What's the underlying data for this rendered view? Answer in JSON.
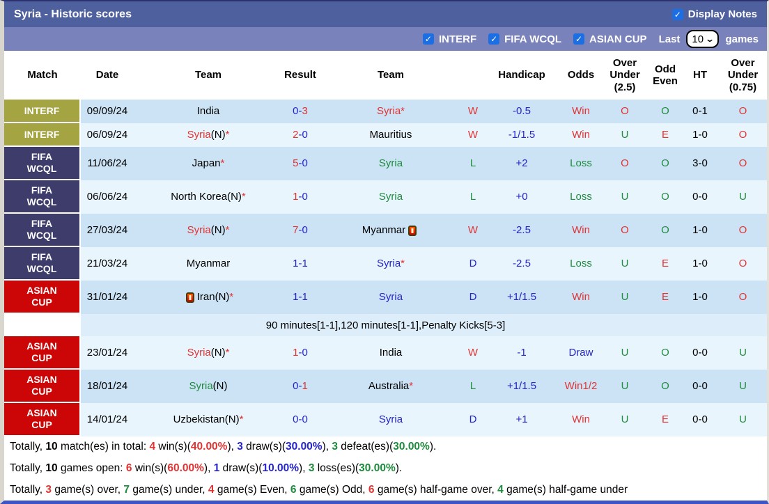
{
  "title_bar": {
    "title": "Syria - Historic scores",
    "display_notes_label": "Display Notes"
  },
  "filter_bar": {
    "filters": [
      "INTERF",
      "FIFA WCQL",
      "ASIAN CUP"
    ],
    "last_label": "Last",
    "games_count": "10",
    "games_label": "games"
  },
  "colors": {
    "red": "#e23333",
    "blue": "#2525cc",
    "green": "#1e8c3c",
    "black": "#000000",
    "interf_bg": "#a4a443",
    "fifa_bg": "#3d3c6b",
    "asian_bg": "#cc0606",
    "stripe_dark": "#cbe3f4",
    "stripe_light": "#e9f5fd",
    "note_bg": "#ddeefa",
    "title_bar_bg": "#4f609f",
    "filter_bar_bg": "#7982ba",
    "checkbox_blue": "#1b6fe3"
  },
  "table": {
    "headers": [
      "Match",
      "Date",
      "Team",
      "Result",
      "Team",
      "",
      "Handicap",
      "Odds",
      "Over Under (2.5)",
      "Odd Even",
      "HT",
      "Over Under (0.75)"
    ],
    "rows": [
      {
        "match": {
          "label": "INTERF",
          "comp": "interf"
        },
        "h": 34,
        "stripe": "d",
        "date": "09/09/24",
        "team1": [
          {
            "t": "India",
            "c": "k"
          }
        ],
        "result": [
          {
            "t": "0-",
            "c": "b"
          },
          {
            "t": "3",
            "c": "r"
          }
        ],
        "team2": [
          {
            "t": "Syria",
            "c": "r"
          },
          {
            "t": "*",
            "c": "r"
          }
        ],
        "wdl": [
          {
            "t": "W",
            "c": "r"
          }
        ],
        "handicap": "-0.5",
        "odds": [
          {
            "t": "Win",
            "c": "r"
          }
        ],
        "ou25": [
          {
            "t": "O",
            "c": "r"
          }
        ],
        "oddeven": [
          {
            "t": "O",
            "c": "g"
          }
        ],
        "ht": "0-1",
        "ou075": [
          {
            "t": "O",
            "c": "r"
          }
        ]
      },
      {
        "match": {
          "label": "INTERF",
          "comp": "interf"
        },
        "h": 34,
        "stripe": "l",
        "date": "06/09/24",
        "team1": [
          {
            "t": "Syria",
            "c": "r"
          },
          {
            "t": "(N)",
            "c": "k"
          },
          {
            "t": "*",
            "c": "r"
          }
        ],
        "result": [
          {
            "t": "2",
            "c": "r"
          },
          {
            "t": "-0",
            "c": "b"
          }
        ],
        "team2": [
          {
            "t": "Mauritius",
            "c": "k"
          }
        ],
        "wdl": [
          {
            "t": "W",
            "c": "r"
          }
        ],
        "handicap": "-1/1.5",
        "odds": [
          {
            "t": "Win",
            "c": "r"
          }
        ],
        "ou25": [
          {
            "t": "U",
            "c": "g"
          }
        ],
        "oddeven": [
          {
            "t": "E",
            "c": "r"
          }
        ],
        "ht": "1-0",
        "ou075": [
          {
            "t": "O",
            "c": "r"
          }
        ]
      },
      {
        "match": {
          "label": "FIFA\nWCQL",
          "comp": "fifa"
        },
        "h": 48,
        "stripe": "d",
        "date": "11/06/24",
        "team1": [
          {
            "t": "Japan",
            "c": "k"
          },
          {
            "t": "*",
            "c": "r"
          }
        ],
        "result": [
          {
            "t": "5",
            "c": "r"
          },
          {
            "t": "-0",
            "c": "b"
          }
        ],
        "team2": [
          {
            "t": "Syria",
            "c": "g"
          }
        ],
        "wdl": [
          {
            "t": "L",
            "c": "g"
          }
        ],
        "handicap": "+2",
        "odds": [
          {
            "t": "Loss",
            "c": "g"
          }
        ],
        "ou25": [
          {
            "t": "O",
            "c": "r"
          }
        ],
        "oddeven": [
          {
            "t": "O",
            "c": "g"
          }
        ],
        "ht": "3-0",
        "ou075": [
          {
            "t": "O",
            "c": "r"
          }
        ]
      },
      {
        "match": {
          "label": "FIFA\nWCQL",
          "comp": "fifa"
        },
        "h": 48,
        "stripe": "l",
        "date": "06/06/24",
        "team1": [
          {
            "t": "North Korea(N)",
            "c": "k"
          },
          {
            "t": "*",
            "c": "r"
          }
        ],
        "result": [
          {
            "t": "1",
            "c": "r"
          },
          {
            "t": "-0",
            "c": "b"
          }
        ],
        "team2": [
          {
            "t": "Syria",
            "c": "g"
          }
        ],
        "wdl": [
          {
            "t": "L",
            "c": "g"
          }
        ],
        "handicap": "+0",
        "odds": [
          {
            "t": "Loss",
            "c": "g"
          }
        ],
        "ou25": [
          {
            "t": "U",
            "c": "g"
          }
        ],
        "oddeven": [
          {
            "t": "O",
            "c": "g"
          }
        ],
        "ht": "0-0",
        "ou075": [
          {
            "t": "U",
            "c": "g"
          }
        ]
      },
      {
        "match": {
          "label": "FIFA\nWCQL",
          "comp": "fifa"
        },
        "h": 48,
        "stripe": "d",
        "date": "27/03/24",
        "team1": [
          {
            "t": "Syria",
            "c": "r"
          },
          {
            "t": "(N)",
            "c": "k"
          },
          {
            "t": "*",
            "c": "r"
          }
        ],
        "result": [
          {
            "t": "7",
            "c": "r"
          },
          {
            "t": "-0",
            "c": "b"
          }
        ],
        "team2": [
          {
            "t": "Myanmar",
            "c": "k"
          }
        ],
        "icon_after_team2": true,
        "wdl": [
          {
            "t": "W",
            "c": "r"
          }
        ],
        "handicap": "-2.5",
        "odds": [
          {
            "t": "Win",
            "c": "r"
          }
        ],
        "ou25": [
          {
            "t": "O",
            "c": "r"
          }
        ],
        "oddeven": [
          {
            "t": "O",
            "c": "g"
          }
        ],
        "ht": "1-0",
        "ou075": [
          {
            "t": "O",
            "c": "r"
          }
        ]
      },
      {
        "match": {
          "label": "FIFA\nWCQL",
          "comp": "fifa"
        },
        "h": 48,
        "stripe": "l",
        "date": "21/03/24",
        "team1": [
          {
            "t": "Myanmar",
            "c": "k"
          }
        ],
        "result": [
          {
            "t": "1-1",
            "c": "b"
          }
        ],
        "team2": [
          {
            "t": "Syria",
            "c": "b"
          },
          {
            "t": "*",
            "c": "r"
          }
        ],
        "wdl": [
          {
            "t": "D",
            "c": "b"
          }
        ],
        "handicap": "-2.5",
        "odds": [
          {
            "t": "Loss",
            "c": "g"
          }
        ],
        "ou25": [
          {
            "t": "U",
            "c": "g"
          }
        ],
        "oddeven": [
          {
            "t": "E",
            "c": "r"
          }
        ],
        "ht": "1-0",
        "ou075": [
          {
            "t": "O",
            "c": "r"
          }
        ]
      },
      {
        "match": {
          "label": "ASIAN\nCUP",
          "comp": "asian"
        },
        "h": 48,
        "stripe": "d",
        "date": "31/01/24",
        "team1": [
          {
            "t": "Iran(N)",
            "c": "k"
          },
          {
            "t": "*",
            "c": "r"
          }
        ],
        "icon_before_team1": true,
        "result": [
          {
            "t": "1-1",
            "c": "b"
          }
        ],
        "team2": [
          {
            "t": "Syria",
            "c": "b"
          }
        ],
        "wdl": [
          {
            "t": "D",
            "c": "b"
          }
        ],
        "handicap": "+1/1.5",
        "odds": [
          {
            "t": "Win",
            "c": "r"
          }
        ],
        "ou25": [
          {
            "t": "U",
            "c": "g"
          }
        ],
        "oddeven": [
          {
            "t": "E",
            "c": "r"
          }
        ],
        "ht": "1-0",
        "ou075": [
          {
            "t": "O",
            "c": "r"
          }
        ]
      },
      {
        "type": "note",
        "text": "90 minutes[1-1],120 minutes[1-1],Penalty Kicks[5-3]"
      },
      {
        "match": {
          "label": "ASIAN\nCUP",
          "comp": "asian"
        },
        "h": 48,
        "stripe": "l",
        "date": "23/01/24",
        "team1": [
          {
            "t": "Syria",
            "c": "r"
          },
          {
            "t": "(N)",
            "c": "k"
          },
          {
            "t": "*",
            "c": "r"
          }
        ],
        "result": [
          {
            "t": "1",
            "c": "r"
          },
          {
            "t": "-0",
            "c": "b"
          }
        ],
        "team2": [
          {
            "t": "India",
            "c": "k"
          }
        ],
        "wdl": [
          {
            "t": "W",
            "c": "r"
          }
        ],
        "handicap": "-1",
        "odds": [
          {
            "t": "Draw",
            "c": "b"
          }
        ],
        "ou25": [
          {
            "t": "U",
            "c": "g"
          }
        ],
        "oddeven": [
          {
            "t": "O",
            "c": "g"
          }
        ],
        "ht": "0-0",
        "ou075": [
          {
            "t": "U",
            "c": "g"
          }
        ]
      },
      {
        "match": {
          "label": "ASIAN\nCUP",
          "comp": "asian"
        },
        "h": 48,
        "stripe": "d",
        "date": "18/01/24",
        "team1": [
          {
            "t": "Syria",
            "c": "g"
          },
          {
            "t": "(N)",
            "c": "k"
          }
        ],
        "result": [
          {
            "t": "0-",
            "c": "b"
          },
          {
            "t": "1",
            "c": "r"
          }
        ],
        "team2": [
          {
            "t": "Australia",
            "c": "k"
          },
          {
            "t": "*",
            "c": "r"
          }
        ],
        "wdl": [
          {
            "t": "L",
            "c": "g"
          }
        ],
        "handicap": "+1/1.5",
        "odds": [
          {
            "t": "Win1/2",
            "c": "r"
          }
        ],
        "ou25": [
          {
            "t": "U",
            "c": "g"
          }
        ],
        "oddeven": [
          {
            "t": "O",
            "c": "g"
          }
        ],
        "ht": "0-0",
        "ou075": [
          {
            "t": "U",
            "c": "g"
          }
        ]
      },
      {
        "match": {
          "label": "ASIAN\nCUP",
          "comp": "asian"
        },
        "h": 48,
        "stripe": "l",
        "date": "14/01/24",
        "team1": [
          {
            "t": "Uzbekistan(N)",
            "c": "k"
          },
          {
            "t": "*",
            "c": "r"
          }
        ],
        "result": [
          {
            "t": "0-0",
            "c": "b"
          }
        ],
        "team2": [
          {
            "t": "Syria",
            "c": "b"
          }
        ],
        "wdl": [
          {
            "t": "D",
            "c": "b"
          }
        ],
        "handicap": "+1",
        "odds": [
          {
            "t": "Win",
            "c": "r"
          }
        ],
        "ou25": [
          {
            "t": "U",
            "c": "g"
          }
        ],
        "oddeven": [
          {
            "t": "E",
            "c": "r"
          }
        ],
        "ht": "0-0",
        "ou075": [
          {
            "t": "U",
            "c": "g"
          }
        ]
      }
    ]
  },
  "summary": {
    "lines": [
      [
        {
          "t": "Totally, ",
          "c": "k"
        },
        {
          "t": "10",
          "c": "k",
          "b": 1
        },
        {
          "t": " match(es) in total: ",
          "c": "k"
        },
        {
          "t": "4",
          "c": "r",
          "b": 1
        },
        {
          "t": " win(s)(",
          "c": "k"
        },
        {
          "t": "40.00%",
          "c": "r",
          "b": 1
        },
        {
          "t": "), ",
          "c": "k"
        },
        {
          "t": "3",
          "c": "b",
          "b": 1
        },
        {
          "t": " draw(s)(",
          "c": "k"
        },
        {
          "t": "30.00%",
          "c": "b",
          "b": 1
        },
        {
          "t": "), ",
          "c": "k"
        },
        {
          "t": "3",
          "c": "g",
          "b": 1
        },
        {
          "t": " defeat(es)(",
          "c": "k"
        },
        {
          "t": "30.00%",
          "c": "g",
          "b": 1
        },
        {
          "t": ").",
          "c": "k"
        }
      ],
      [
        {
          "t": "Totally, ",
          "c": "k"
        },
        {
          "t": "10",
          "c": "k",
          "b": 1
        },
        {
          "t": " games open: ",
          "c": "k"
        },
        {
          "t": "6",
          "c": "r",
          "b": 1
        },
        {
          "t": " win(s)(",
          "c": "k"
        },
        {
          "t": "60.00%",
          "c": "r",
          "b": 1
        },
        {
          "t": "), ",
          "c": "k"
        },
        {
          "t": "1",
          "c": "b",
          "b": 1
        },
        {
          "t": " draw(s)(",
          "c": "k"
        },
        {
          "t": "10.00%",
          "c": "b",
          "b": 1
        },
        {
          "t": "), ",
          "c": "k"
        },
        {
          "t": "3",
          "c": "g",
          "b": 1
        },
        {
          "t": " loss(es)(",
          "c": "k"
        },
        {
          "t": "30.00%",
          "c": "g",
          "b": 1
        },
        {
          "t": ").",
          "c": "k"
        }
      ],
      [
        {
          "t": "Totally, ",
          "c": "k"
        },
        {
          "t": "3",
          "c": "r",
          "b": 1
        },
        {
          "t": " game(s) over, ",
          "c": "k"
        },
        {
          "t": "7",
          "c": "g",
          "b": 1
        },
        {
          "t": " game(s) under, ",
          "c": "k"
        },
        {
          "t": "4",
          "c": "r",
          "b": 1
        },
        {
          "t": " game(s) Even, ",
          "c": "k"
        },
        {
          "t": "6",
          "c": "g",
          "b": 1
        },
        {
          "t": " game(s) Odd, ",
          "c": "k"
        },
        {
          "t": "6",
          "c": "r",
          "b": 1
        },
        {
          "t": " game(s) half-game over, ",
          "c": "k"
        },
        {
          "t": "4",
          "c": "g",
          "b": 1
        },
        {
          "t": " game(s) half-game under",
          "c": "k"
        }
      ]
    ]
  }
}
